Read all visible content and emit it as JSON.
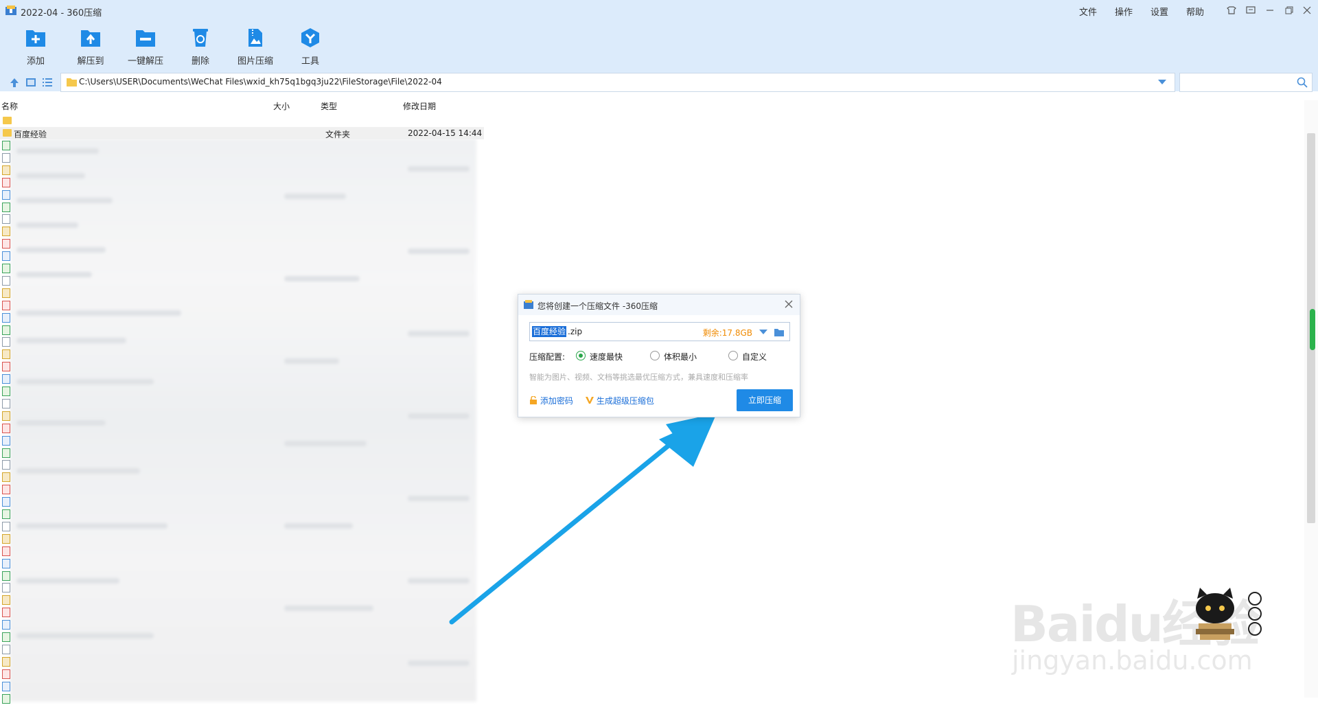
{
  "window": {
    "title": "2022-04 - 360压缩",
    "menu": [
      "文件",
      "操作",
      "设置",
      "帮助"
    ]
  },
  "toolbar": {
    "add": "添加",
    "extract_to": "解压到",
    "one_click_extract": "一键解压",
    "delete": "删除",
    "image_compress": "图片压缩",
    "tools": "工具"
  },
  "address": {
    "path": "C:\\Users\\USER\\Documents\\WeChat Files\\wxid_kh75q1bgq3ju22\\FileStorage\\File\\2022-04",
    "search_placeholder": ""
  },
  "list": {
    "columns": {
      "name": "名称",
      "size": "大小",
      "type": "类型",
      "modified": "修改日期"
    },
    "selected_row": {
      "name": "百度经验",
      "size": "",
      "type": "文件夹",
      "modified": "2022-04-15 14:44"
    }
  },
  "dialog": {
    "title": "您将创建一个压缩文件 -360压缩",
    "filename_selected": "百度经验",
    "filename_ext": ".zip",
    "free_space": "剩余:17.8GB",
    "config_label": "压缩配置:",
    "options": [
      "速度最快",
      "体积最小",
      "自定义"
    ],
    "selected_option": "速度最快",
    "hint": "智能为图片、视频、文档等挑选最优压缩方式，兼具速度和压缩率",
    "add_password": "添加密码",
    "super_package": "生成超级压缩包",
    "compress_now": "立即压缩"
  },
  "watermark": {
    "logo": "Baidu经验",
    "url": "jingyan.baidu.com"
  },
  "colors": {
    "toolbar_bg": "#dcebfb",
    "accent_blue": "#1f8ae6",
    "free_space": "#f08a00",
    "radio_on": "#2aa64a",
    "arrow": "#1aa3e8"
  }
}
